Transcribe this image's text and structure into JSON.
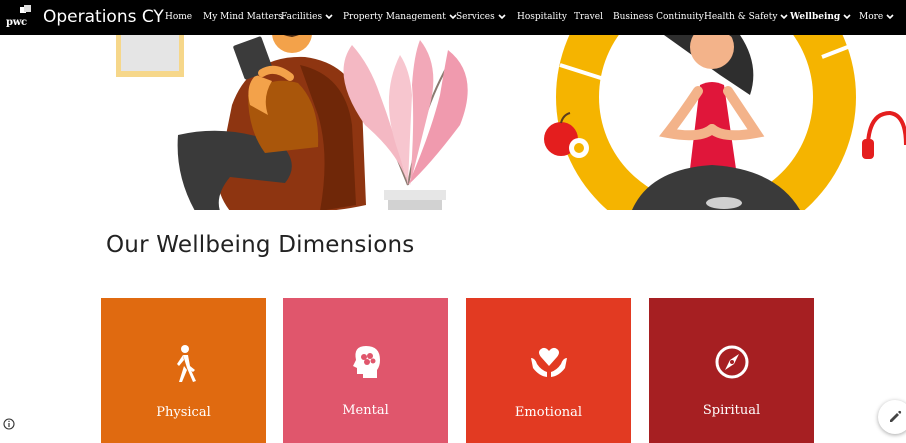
{
  "site": {
    "logo_text": "pwc",
    "title": "Operations CY"
  },
  "nav": {
    "items": [
      {
        "label": "Home",
        "dropdown": false,
        "active": false
      },
      {
        "label": "My Mind Matters",
        "dropdown": false,
        "active": false
      },
      {
        "label": "Facilities",
        "dropdown": true,
        "active": false
      },
      {
        "label": "Property Management",
        "dropdown": true,
        "active": false
      },
      {
        "label": "Services",
        "dropdown": true,
        "active": false
      },
      {
        "label": "Hospitality",
        "dropdown": false,
        "active": false
      },
      {
        "label": "Travel",
        "dropdown": false,
        "active": false
      },
      {
        "label": "Business Continuity",
        "dropdown": false,
        "active": false
      },
      {
        "label": "Health & Safety",
        "dropdown": true,
        "active": false
      },
      {
        "label": "Wellbeing",
        "dropdown": true,
        "active": true
      },
      {
        "label": "More",
        "dropdown": true,
        "active": false
      }
    ]
  },
  "section": {
    "heading": "Our Wellbeing Dimensions"
  },
  "cards": [
    {
      "label": "Physical",
      "color": "#e06a10",
      "icon": "walking-person-icon"
    },
    {
      "label": "Mental",
      "color": "#e0566c",
      "icon": "head-brain-icon"
    },
    {
      "label": "Emotional",
      "color": "#e23a22",
      "icon": "heart-in-hands-icon"
    },
    {
      "label": "Spiritual",
      "color": "#a61f22",
      "icon": "compass-icon"
    }
  ],
  "colors": {
    "nav_bg": "#000000",
    "hero_yellow": "#f5b400",
    "text": "#222222"
  }
}
